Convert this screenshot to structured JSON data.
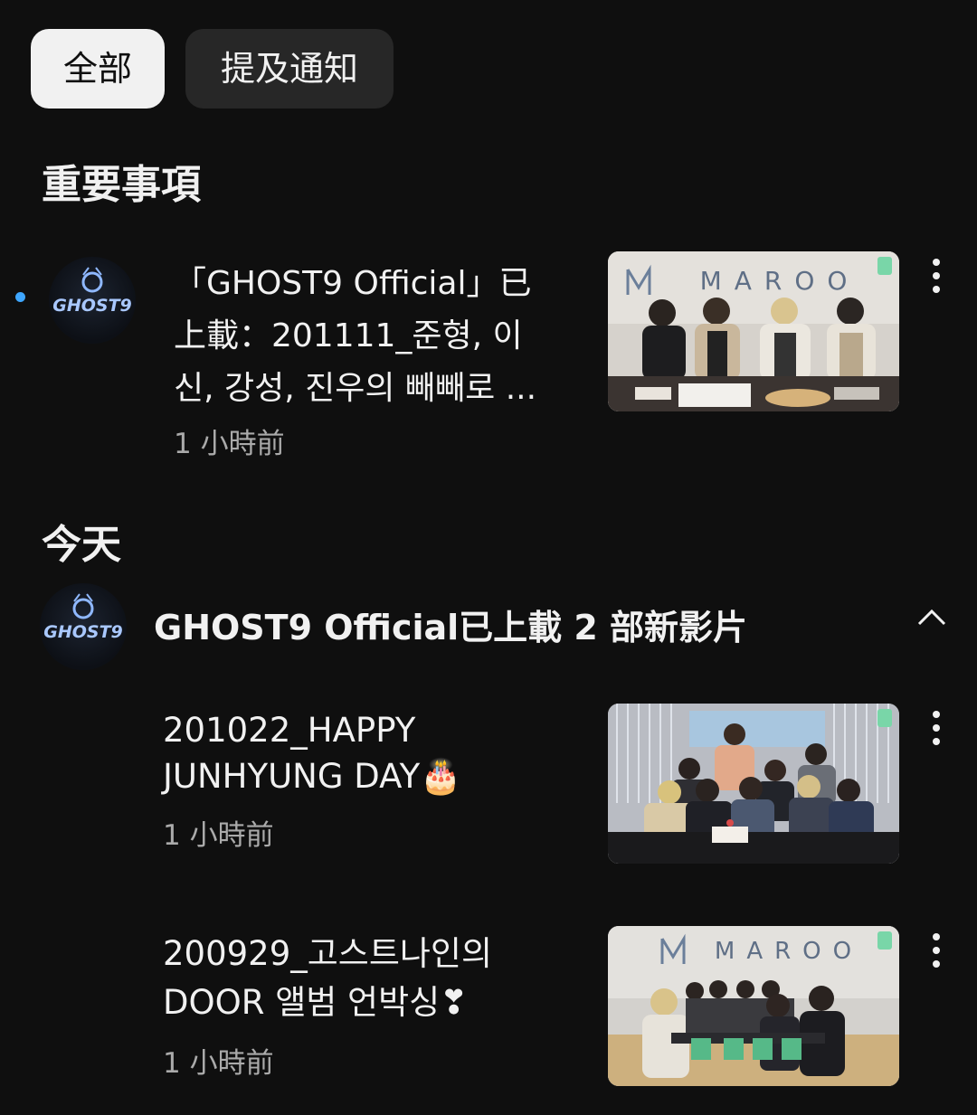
{
  "chips": {
    "all": "全部",
    "mentions": "提及通知"
  },
  "sections": {
    "important": "重要事項",
    "today": "今天"
  },
  "important_notification": {
    "title_line1": "「GHOST9 Official」已",
    "title_line2": "上載：201111_준형, 이",
    "title_line3": "신, 강성, 진우의 빼빼로 ...",
    "time": "1 小時前",
    "avatar_text": "GHOST9",
    "thumb_brand": "MAROO"
  },
  "group": {
    "header": "GHOST9 Official已上載 2 部新影片",
    "avatar_text": "GHOST9",
    "items": [
      {
        "title_line1": "201022_HAPPY",
        "title_line2": "JUNHYUNG DAY🎂",
        "time": "1 小時前"
      },
      {
        "title_line1": "200929_고스트나인의",
        "title_line2": "DOOR 앨범 언박싱❣",
        "time": "1 小時前",
        "thumb_brand": "MAROO"
      }
    ]
  },
  "icons": {
    "more": "more-vert-icon",
    "collapse": "chevron-up-icon",
    "unread": "unread-dot"
  },
  "colors": {
    "background": "#0f0f0f",
    "unread_dot": "#3ea6ff",
    "chip_active_bg": "#f1f1f1",
    "chip_inactive_bg": "#272727",
    "secondary_text": "#aaaaaa"
  }
}
